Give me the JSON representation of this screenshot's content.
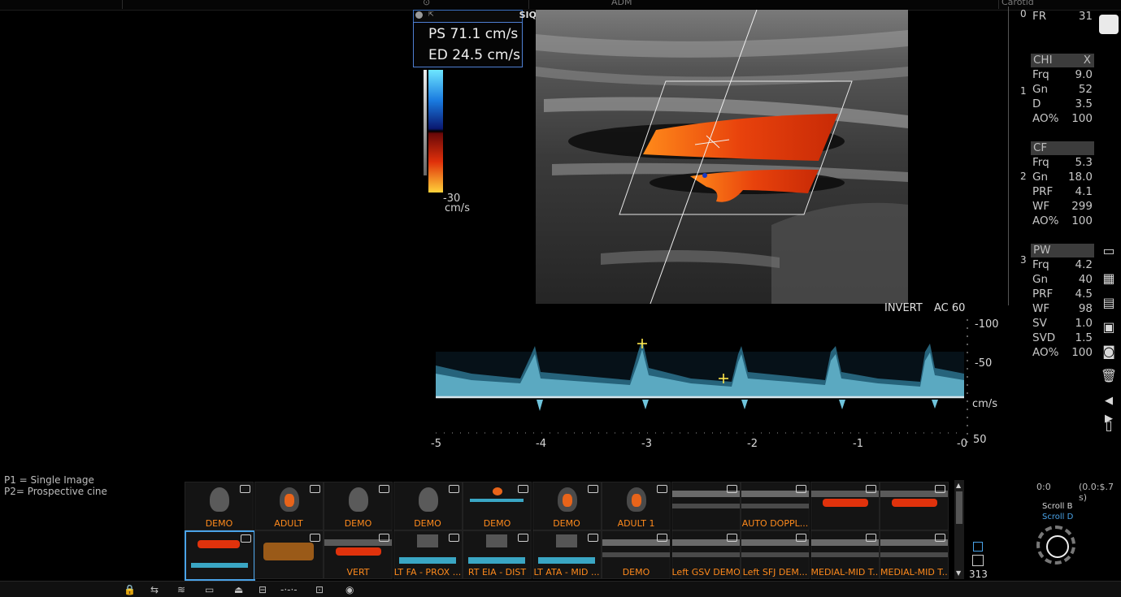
{
  "top_bar": {
    "center_label": "ADM",
    "right_label": "Carotid"
  },
  "measurement": {
    "ps": "PS  71.1 cm/s",
    "ed": "ED  24.5 cm/s",
    "head_right": "SIQ"
  },
  "color_scale": {
    "bottom_value": "-30",
    "unit": "cm/s"
  },
  "depth_markers": [
    "0",
    "1",
    "2",
    "3"
  ],
  "params": {
    "fr": {
      "label": "FR",
      "value": "31"
    },
    "chi": {
      "header": "CHI",
      "header_right": "X",
      "rows": [
        {
          "label": "Frq",
          "value": "9.0"
        },
        {
          "label": "Gn",
          "value": "52"
        },
        {
          "label": "D",
          "value": "3.5"
        },
        {
          "label": "AO%",
          "value": "100"
        }
      ]
    },
    "cf": {
      "header": "CF",
      "rows": [
        {
          "label": "Frq",
          "value": "5.3"
        },
        {
          "label": "Gn",
          "value": "18.0"
        },
        {
          "label": "PRF",
          "value": "4.1"
        },
        {
          "label": "WF",
          "value": "299"
        },
        {
          "label": "AO%",
          "value": "100"
        }
      ]
    },
    "pw": {
      "header": "PW",
      "rows": [
        {
          "label": "Frq",
          "value": "4.2"
        },
        {
          "label": "Gn",
          "value": "40"
        },
        {
          "label": "PRF",
          "value": "4.5"
        },
        {
          "label": "WF",
          "value": "98"
        },
        {
          "label": "SV",
          "value": "1.0"
        },
        {
          "label": "SVD",
          "value": "1.5"
        },
        {
          "label": "AO%",
          "value": "100"
        }
      ]
    }
  },
  "doppler": {
    "invert": "INVERT",
    "ac": "AC 60",
    "y_ticks": [
      "-100",
      "-50",
      "cm/s",
      "50"
    ],
    "x_ticks": [
      "-5",
      "-4",
      "-3",
      "-2",
      "-1",
      "-0"
    ]
  },
  "presets_legend": {
    "p1": "P1 = Single Image",
    "p2": "P2= Prospective cine"
  },
  "thumbnails_row1": [
    {
      "caption": "DEMO",
      "kind": "heart"
    },
    {
      "caption": "ADULT",
      "kind": "heart-color"
    },
    {
      "caption": "DEMO",
      "kind": "heart"
    },
    {
      "caption": "DEMO",
      "kind": "heart"
    },
    {
      "caption": "DEMO",
      "kind": "color-dot"
    },
    {
      "caption": "DEMO",
      "kind": "heart-color"
    },
    {
      "caption": "ADULT 1",
      "kind": "heart-color"
    },
    {
      "caption": "",
      "kind": "vessel"
    },
    {
      "caption": "AUTO DOPPL...",
      "kind": "vessel"
    },
    {
      "caption": "",
      "kind": "vessel-color"
    },
    {
      "caption": "",
      "kind": "vessel-color"
    }
  ],
  "thumbnails_row2": [
    {
      "caption": "",
      "kind": "vessel-color-doppler",
      "selected": true
    },
    {
      "caption": "",
      "kind": "vessel-orange"
    },
    {
      "caption": "VERT",
      "kind": "vessel-color"
    },
    {
      "caption": "LT FA - PROX ...",
      "kind": "doppler"
    },
    {
      "caption": "RT EIA - DIST",
      "kind": "doppler"
    },
    {
      "caption": "LT ATA - MID ...",
      "kind": "doppler"
    },
    {
      "caption": "DEMO",
      "kind": "vessel"
    },
    {
      "caption": "Left GSV DEMO",
      "kind": "vessel"
    },
    {
      "caption": "Left SFJ DEM...",
      "kind": "vessel"
    },
    {
      "caption": "MEDIAL-MID T...",
      "kind": "vessel"
    },
    {
      "caption": "MEDIAL-MID T...",
      "kind": "vessel"
    }
  ],
  "clip_count": "313",
  "cine": {
    "left": "0:0",
    "right": "(0.0:$.7 s)"
  },
  "scroll": {
    "b": "Scroll B",
    "d": "Scroll D"
  },
  "colors": {
    "accent_blue": "#4aa3e8",
    "caption_orange": "#ff8a1c",
    "trace_cyan": "#7fd8f0",
    "marker_yellow": "#ffe74a"
  }
}
